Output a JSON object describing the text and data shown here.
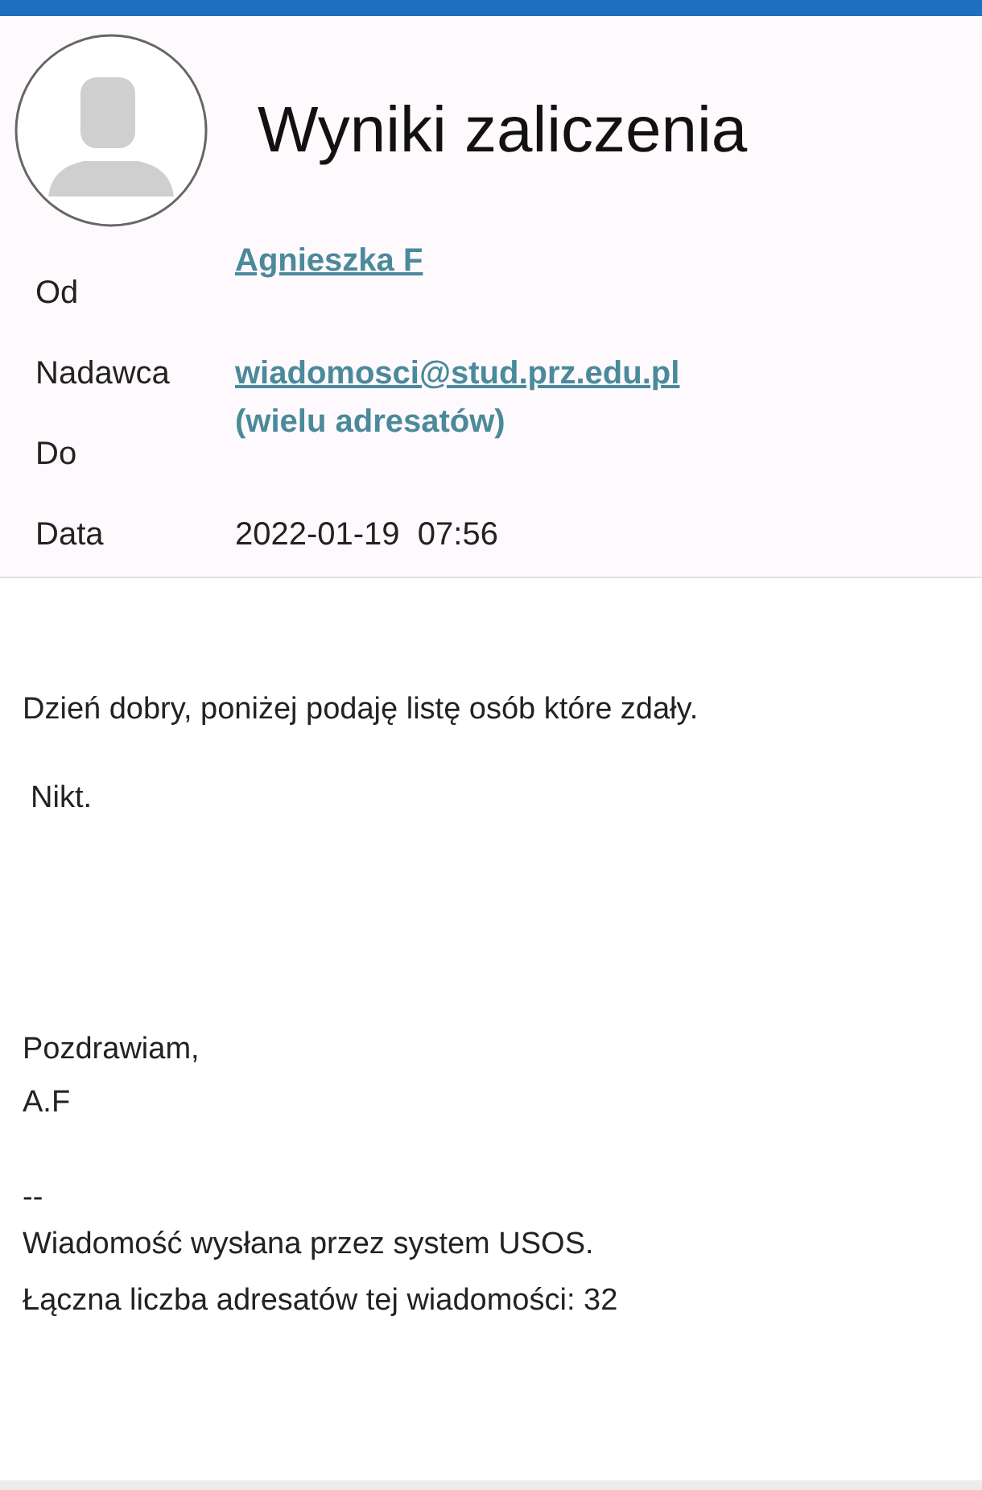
{
  "title": "Wyniki zaliczenia",
  "headers": [
    {
      "label": "Od",
      "value": "Agnieszka F",
      "kind": "link"
    },
    {
      "label": "Nadawca",
      "value": "wiadomosci@stud.prz.edu.pl",
      "kind": "link"
    },
    {
      "label": "Do",
      "value": "(wielu adresatów)",
      "kind": "note"
    },
    {
      "label": "Data",
      "value": "2022-01-19  07:56",
      "kind": "plain"
    }
  ],
  "body": {
    "greeting": "Dzień dobry, poniżej podaję listę osób które zdały.",
    "answer": "Nikt.",
    "closing": "Pozdrawiam,",
    "signature": "A.F",
    "separator": "--",
    "footer": [
      "Wiadomość wysłana przez system USOS.",
      "Łączna liczba adresatów tej wiadomości: 32"
    ]
  }
}
